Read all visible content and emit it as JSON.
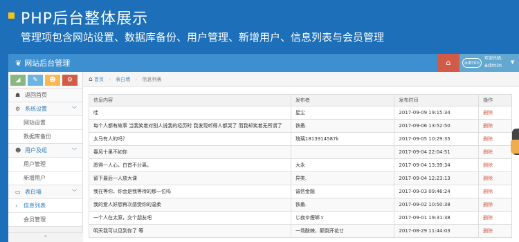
{
  "slide": {
    "title": "PHP后台整体展示",
    "subtitle": "管理项包含网站设置、数据库备份、用户管理、新增用户、信息列表与会员管理"
  },
  "navbar": {
    "brand": "网站后台管理",
    "home_icon": "⌂",
    "welcome": "欢迎光临，",
    "username": "admin",
    "avatar_label": "admin"
  },
  "sidebar": {
    "shortcuts": [
      {
        "icon": "signal-icon",
        "glyph": "◢",
        "color": "#87b87f"
      },
      {
        "icon": "pencil-icon",
        "glyph": "✎",
        "color": "#6fb3e0"
      },
      {
        "icon": "group-icon",
        "glyph": "☻",
        "color": "#ffb752"
      },
      {
        "icon": "cogs-icon",
        "glyph": "⚙",
        "color": "#d15b47"
      }
    ],
    "items": [
      {
        "label": "返回首页",
        "icon": "☗"
      },
      {
        "label": "系统设置",
        "icon": "⚙"
      },
      {
        "label": "网站设置"
      },
      {
        "label": "数据库备份"
      },
      {
        "label": "用户及组",
        "icon": "☻"
      },
      {
        "label": "用户管理"
      },
      {
        "label": "新增用户"
      },
      {
        "label": "表白墙",
        "icon": "▭"
      },
      {
        "label": "信息列表"
      },
      {
        "label": "会员管理"
      }
    ],
    "collapse": "«"
  },
  "breadcrumb": {
    "home": "首页",
    "section": "表白墙",
    "current": "信息列表"
  },
  "table": {
    "headers": [
      "信息内容",
      "发布者",
      "发布时间",
      "操作"
    ],
    "rows": [
      [
        "哇",
        "星尘",
        "2017-09-09 19:15:34",
        "删除"
      ],
      [
        "每个人都有故事 当我笑着对别人说我的经历时 我发现听得人都哭了 而我却笑着无所谓了",
        "铁甬.",
        "2017-09-06 13:52:50",
        "删除"
      ],
      [
        "太马有人的吗？",
        "琉璃1813914587k",
        "2017-09-05 10:29:35",
        "删除"
      ],
      [
        "春风十里不如你",
        "",
        "2017-09-04 22:04:51",
        "删除"
      ],
      [
        "愿得一人心，白首不分离。",
        "大永",
        "2017-09-04 13:39:34",
        "删除"
      ],
      [
        "留下最后一人放大课",
        "异类.",
        "2017-09-04 12:23:13",
        "删除"
      ],
      [
        "我在等你，你会是我等待的那一位吗",
        "诚信金融",
        "2017-09-03 09:46:24",
        "删除"
      ],
      [
        "我的爱人好想再次感受你的温柔",
        "铁甬.",
        "2017-09-02 10:50:38",
        "删除"
      ],
      [
        "一个人在太原，交个朋友吧",
        "じ寂ゆ煙瑯ゞ",
        "2017-09-01 19:31:38",
        "删除"
      ],
      [
        "明天我可以见到你了 等",
        "一场酸辣，颠倒开花ㄝ",
        "2017-08-29 11:44:03",
        "删除"
      ]
    ]
  }
}
